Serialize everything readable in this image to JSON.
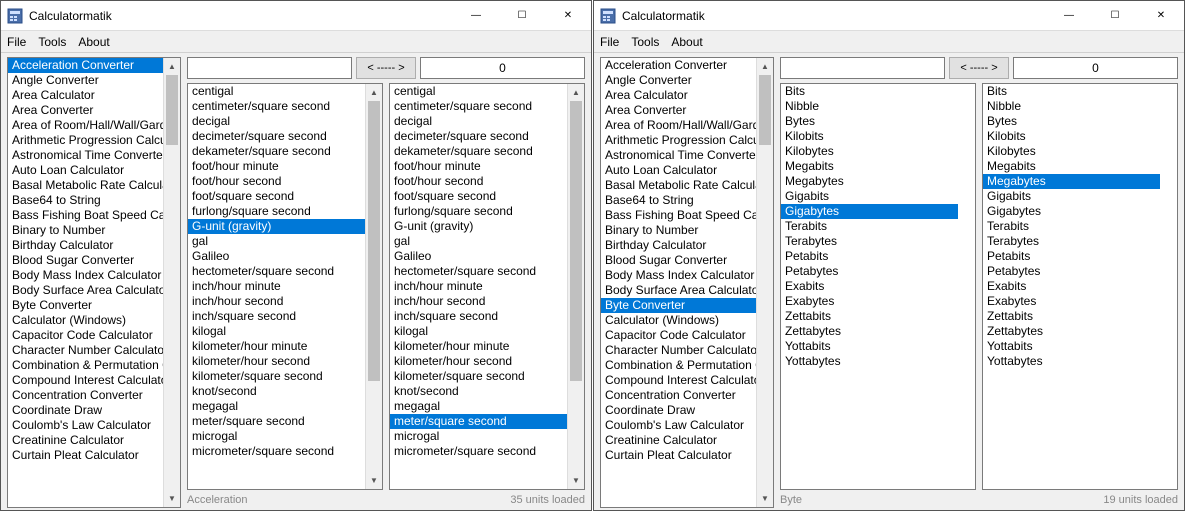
{
  "windows": [
    {
      "title": "Calculatormatik",
      "menu": [
        "File",
        "Tools",
        "About"
      ],
      "converters": [
        "Acceleration Converter",
        "Angle Converter",
        "Area Calculator",
        "Area Converter",
        "Area of Room/Hall/Wall/Garden/Yard",
        "Arithmetic Progression Calculator",
        "Astronomical Time Converter",
        "Auto Loan Calculator",
        "Basal Metabolic Rate Calculator",
        "Base64 to String",
        "Bass Fishing Boat Speed Calculator",
        "Binary to Number",
        "Birthday Calculator",
        "Blood Sugar Converter",
        "Body Mass Index Calculator",
        "Body Surface Area Calculator",
        "Byte Converter",
        "Calculator (Windows)",
        "Capacitor Code Calculator",
        "Character Number Calculator",
        "Combination & Permutation Calculator",
        "Compound Interest Calculator",
        "Concentration Converter",
        "Coordinate Draw",
        "Coulomb's Law Calculator",
        "Creatinine Calculator",
        "Curtain Pleat Calculator"
      ],
      "converters_selected": 0,
      "converters_thumb_h": 70,
      "input_value": "",
      "output_value": "0",
      "convert_label": "< ----- >",
      "units_from": [
        "centigal",
        "centimeter/square second",
        "decigal",
        "decimeter/square second",
        "dekameter/square second",
        "foot/hour minute",
        "foot/hour second",
        "foot/square second",
        "furlong/square second",
        "G-unit (gravity)",
        "gal",
        "Galileo",
        "hectometer/square second",
        "inch/hour minute",
        "inch/hour second",
        "inch/square second",
        "kilogal",
        "kilometer/hour minute",
        "kilometer/hour second",
        "kilometer/square second",
        "knot/second",
        "megagal",
        "meter/square second",
        "microgal",
        "micrometer/square second"
      ],
      "units_from_selected": 9,
      "units_from_scroll": true,
      "units_from_thumb_h": 280,
      "units_to": [
        "centigal",
        "centimeter/square second",
        "decigal",
        "decimeter/square second",
        "dekameter/square second",
        "foot/hour minute",
        "foot/hour second",
        "foot/square second",
        "furlong/square second",
        "G-unit (gravity)",
        "gal",
        "Galileo",
        "hectometer/square second",
        "inch/hour minute",
        "inch/hour second",
        "inch/square second",
        "kilogal",
        "kilometer/hour minute",
        "kilometer/hour second",
        "kilometer/square second",
        "knot/second",
        "megagal",
        "meter/square second",
        "microgal",
        "micrometer/square second"
      ],
      "units_to_selected": 22,
      "units_to_scroll": true,
      "units_to_thumb_h": 280,
      "status_left": "Acceleration",
      "status_right": "35 units loaded"
    },
    {
      "title": "Calculatormatik",
      "menu": [
        "File",
        "Tools",
        "About"
      ],
      "converters": [
        "Acceleration Converter",
        "Angle Converter",
        "Area Calculator",
        "Area Converter",
        "Area of Room/Hall/Wall/Garden/Yard",
        "Arithmetic Progression Calculator",
        "Astronomical Time Converter",
        "Auto Loan Calculator",
        "Basal Metabolic Rate Calculator",
        "Base64 to String",
        "Bass Fishing Boat Speed Calculator",
        "Binary to Number",
        "Birthday Calculator",
        "Blood Sugar Converter",
        "Body Mass Index Calculator",
        "Body Surface Area Calculator",
        "Byte Converter",
        "Calculator (Windows)",
        "Capacitor Code Calculator",
        "Character Number Calculator",
        "Combination & Permutation Calculator",
        "Compound Interest Calculator",
        "Concentration Converter",
        "Coordinate Draw",
        "Coulomb's Law Calculator",
        "Creatinine Calculator",
        "Curtain Pleat Calculator"
      ],
      "converters_selected": 16,
      "converters_thumb_h": 70,
      "input_value": "",
      "output_value": "0",
      "convert_label": "< ----- >",
      "units_from": [
        "Bits",
        "Nibble",
        "Bytes",
        "Kilobits",
        "Kilobytes",
        "Megabits",
        "Megabytes",
        "Gigabits",
        "Gigabytes",
        "Terabits",
        "Terabytes",
        "Petabits",
        "Petabytes",
        "Exabits",
        "Exabytes",
        "Zettabits",
        "Zettabytes",
        "Yottabits",
        "Yottabytes"
      ],
      "units_from_selected": 8,
      "units_from_scroll": false,
      "units_to": [
        "Bits",
        "Nibble",
        "Bytes",
        "Kilobits",
        "Kilobytes",
        "Megabits",
        "Megabytes",
        "Gigabits",
        "Gigabytes",
        "Terabits",
        "Terabytes",
        "Petabits",
        "Petabytes",
        "Exabits",
        "Exabytes",
        "Zettabits",
        "Zettabytes",
        "Yottabits",
        "Yottabytes"
      ],
      "units_to_selected": 6,
      "units_to_scroll": false,
      "status_left": "Byte",
      "status_right": "19 units loaded"
    }
  ]
}
